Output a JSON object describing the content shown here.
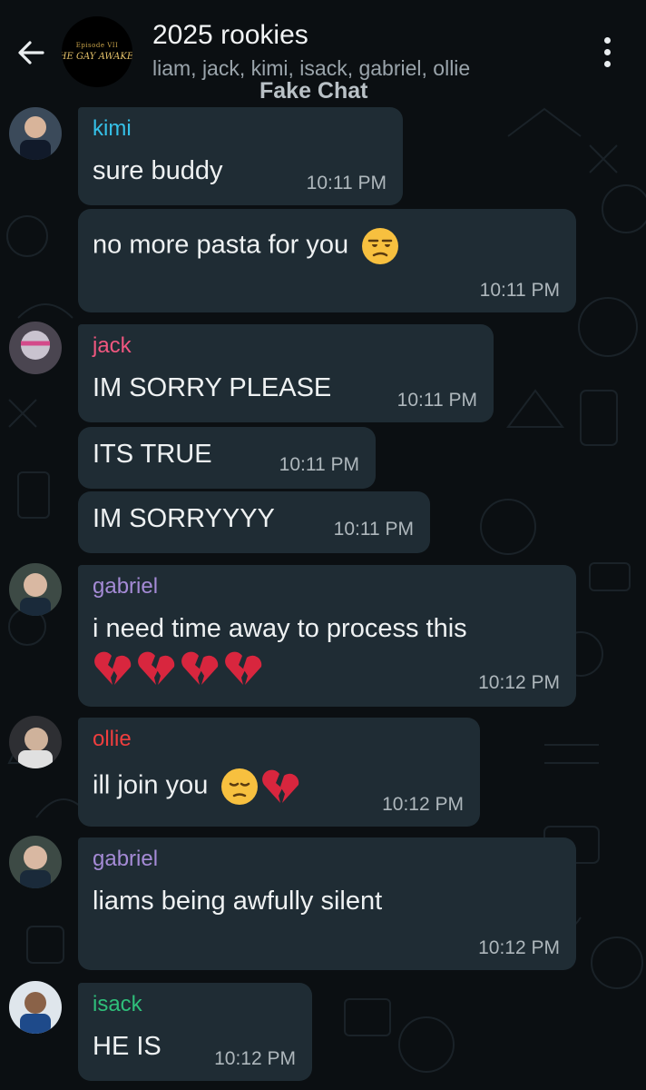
{
  "header": {
    "title": "2025 rookies",
    "members": "liam, jack, kimi, isack, gabriel, ollie",
    "watermark": "Fake Chat",
    "avatar_line1": "Episode VII",
    "avatar_line2": "THE GAY AWAKEN",
    "back_icon": "arrow-left-icon",
    "menu_icon": "more-vertical-icon"
  },
  "colors": {
    "background": "#0b0f12",
    "bubble": "#1f2c34",
    "kimi": "#35c1e8",
    "jack": "#f0577f",
    "gabriel": "#a58bd6",
    "ollie": "#ef3e3e",
    "isack": "#2fbf7a",
    "timestamp": "#aeb7bc"
  },
  "messages": [
    {
      "sender": "kimi",
      "text": "sure buddy",
      "time": "10:11 PM"
    },
    {
      "text": "no more pasta for you",
      "emoji": "unamused-face",
      "time": "10:11 PM"
    },
    {
      "sender": "jack",
      "text": "IM SORRY PLEASE",
      "time": "10:11 PM"
    },
    {
      "text": "ITS TRUE",
      "time": "10:11 PM"
    },
    {
      "text": "IM SORRYYYY",
      "time": "10:11 PM"
    },
    {
      "sender": "gabriel",
      "text": "i need time away to process this",
      "emoji": "broken-heart x4",
      "time": "10:12 PM"
    },
    {
      "sender": "ollie",
      "text": "ill join you",
      "emoji": "pensive-face broken-heart",
      "time": "10:12 PM"
    },
    {
      "sender": "gabriel",
      "text": "liams being awfully silent",
      "time": "10:12 PM"
    },
    {
      "sender": "isack",
      "text": "HE IS",
      "time": "10:12 PM"
    }
  ]
}
